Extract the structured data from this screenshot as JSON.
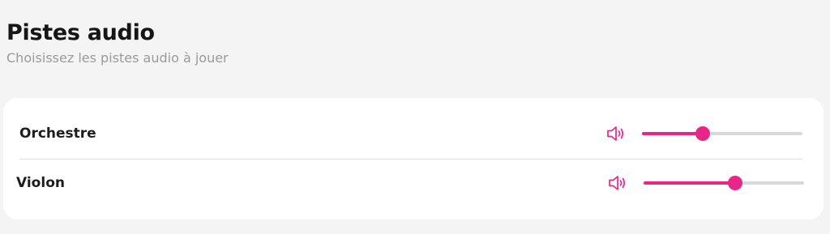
{
  "header": {
    "title": "Pistes audio",
    "subtitle": "Choisissez les pistes audio à jouer"
  },
  "colors": {
    "accent": "#e8268a",
    "track_bg": "#d9d9d9"
  },
  "tracks": [
    {
      "label": "Orchestre",
      "icon": "speaker-icon",
      "volume": 0.38
    },
    {
      "label": "Violon",
      "icon": "speaker-icon",
      "volume": 0.57
    }
  ]
}
